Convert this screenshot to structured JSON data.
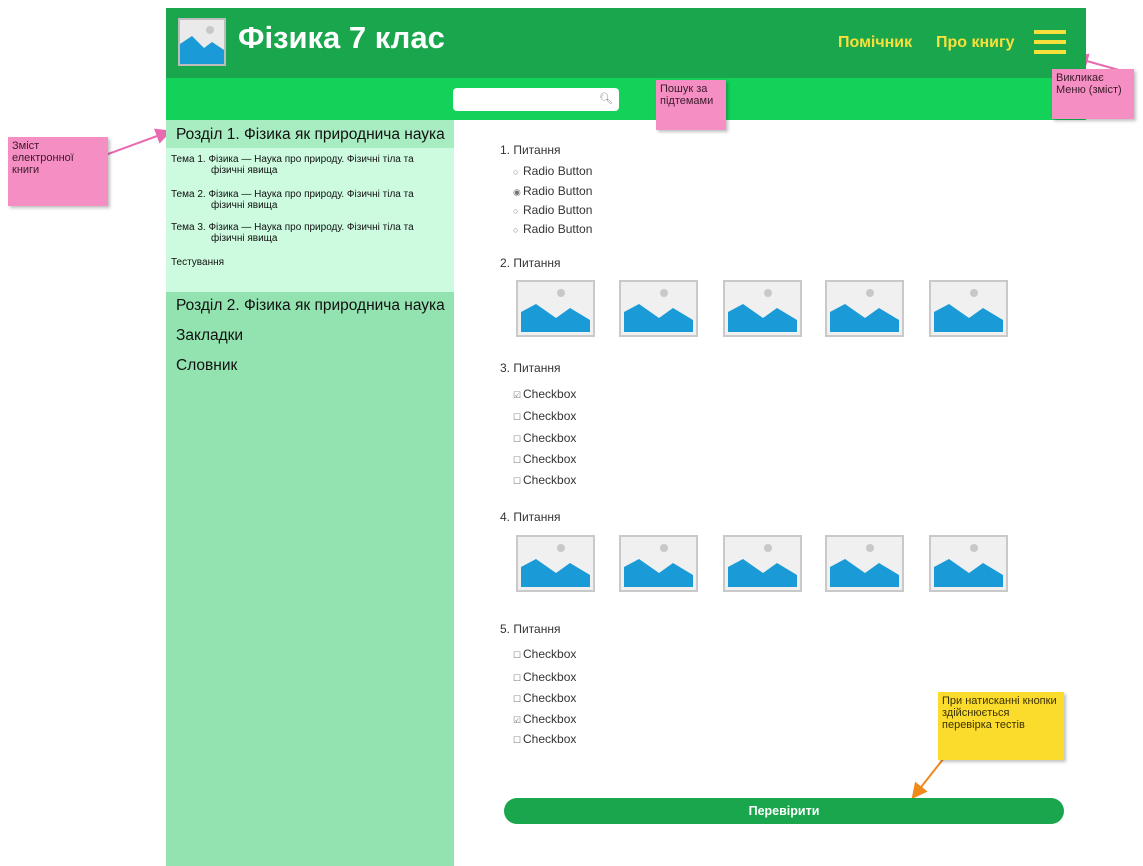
{
  "header": {
    "title": "Фізика 7 клас",
    "nav": {
      "helper": "Помічник",
      "about": "Про книгу"
    },
    "logo_icon": "image-placeholder-icon",
    "menu_icon": "hamburger-menu-icon"
  },
  "search": {
    "value": "",
    "placeholder": "",
    "icon": "search-icon"
  },
  "sidebar": {
    "section1_title": "Розділ 1. Фізика як природнича наука",
    "topics": [
      {
        "line1": "Тема 1. Фізика — Наука про природу. Фізичні тіла та",
        "line2": "фізичні явища"
      },
      {
        "line1": "Тема 2. Фізика — Наука про природу. Фізичні тіла та",
        "line2": "фізичні явища"
      },
      {
        "line1": "Тема 3. Фізика — Наука про природу. Фізичні тіла та",
        "line2": "фізичні явища"
      }
    ],
    "testing": "Тестування",
    "section2_title": "Розділ 2. Фізика як природнича наука",
    "bookmarks": "Закладки",
    "dictionary": "Словник"
  },
  "questions": {
    "q1": {
      "title": "1. Питання",
      "options": [
        "Radio Button",
        "Radio Button",
        "Radio Button",
        "Radio Button"
      ],
      "selected_index": 1
    },
    "q2": {
      "title": "2. Питання",
      "image_count": 5
    },
    "q3": {
      "title": "3. Питання",
      "options": [
        "Checkbox",
        "Checkbox",
        "Checkbox",
        "Checkbox",
        "Checkbox"
      ],
      "checked": [
        true,
        false,
        false,
        false,
        false
      ]
    },
    "q4": {
      "title": "4. Питання",
      "image_count": 5
    },
    "q5": {
      "title": "5. Питання",
      "options": [
        "Checkbox",
        "Checkbox",
        "Checkbox",
        "Checkbox",
        "Checkbox"
      ],
      "checked": [
        false,
        false,
        false,
        true,
        false
      ]
    }
  },
  "check_button": "Перевірити",
  "annotations": {
    "contents": "Зміст електронної книги",
    "search": "Пошук за підтемами",
    "menu": "Викликає Меню (зміст)",
    "check": "При натисканні кнопки здійснюється перевірка тестів"
  },
  "colors": {
    "header_green": "#1aa64d",
    "search_green": "#12d25a",
    "nav_yellow": "#f7e03c",
    "sidebar_green": "#93e3b1",
    "note_pink": "#f58fc3",
    "note_yellow": "#fbdc2c",
    "image_blue": "#1a9ad6"
  }
}
